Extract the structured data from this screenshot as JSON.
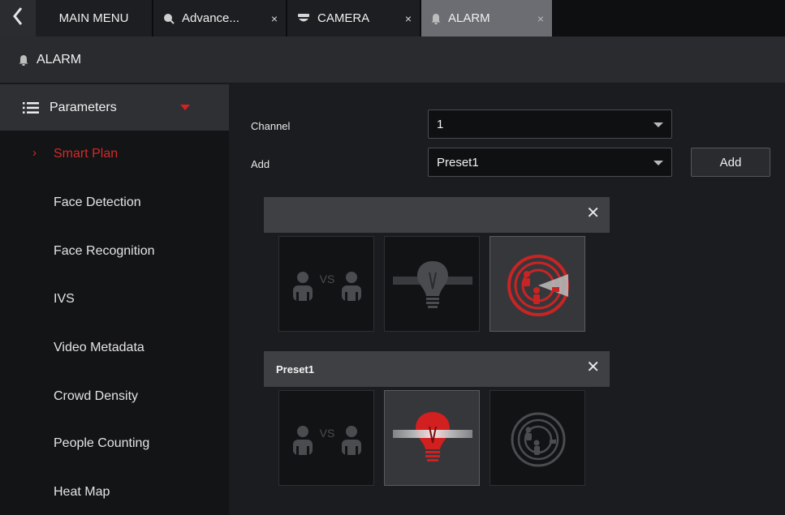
{
  "tabs": [
    {
      "label": "MAIN MENU",
      "icon": "none",
      "active": false
    },
    {
      "label": "Advance...",
      "icon": "search-icon",
      "close": "×",
      "active": false
    },
    {
      "label": "CAMERA",
      "icon": "camera-icon",
      "close": "×",
      "active": false
    },
    {
      "label": "ALARM",
      "icon": "bell-icon",
      "close": "×",
      "active": true
    }
  ],
  "header": {
    "title": "ALARM",
    "icon": "bell-icon"
  },
  "sidebar": {
    "section": {
      "label": "Parameters",
      "icon": "list-icon"
    },
    "items": [
      {
        "label": "Smart Plan",
        "active": true
      },
      {
        "label": "Face Detection"
      },
      {
        "label": "Face Recognition"
      },
      {
        "label": "IVS"
      },
      {
        "label": "Video Metadata"
      },
      {
        "label": "Crowd Density"
      },
      {
        "label": "People Counting"
      },
      {
        "label": "Heat Map"
      }
    ]
  },
  "form": {
    "channel_label": "Channel",
    "channel_value": "1",
    "add_label": "Add",
    "add_value": "Preset1",
    "add_button": "Add"
  },
  "panels": [
    {
      "name": "",
      "close": "✕",
      "tiles": [
        {
          "icon": "face-compare-icon",
          "state": "disabled",
          "vs_text": "VS"
        },
        {
          "icon": "lightbulb-icon",
          "state": "disabled"
        },
        {
          "icon": "radar-icon",
          "state": "selected"
        }
      ]
    },
    {
      "name": "Preset1",
      "close": "✕",
      "tiles": [
        {
          "icon": "face-compare-icon",
          "state": "disabled",
          "vs_text": "VS"
        },
        {
          "icon": "lightbulb-icon",
          "state": "selected"
        },
        {
          "icon": "radar-icon",
          "state": "disabled"
        }
      ]
    }
  ],
  "colors": {
    "accent": "#d32a2a",
    "tab_active": "#6b6d72",
    "sidebar_bg": "#131416",
    "panel_bar": "#3f4044"
  }
}
